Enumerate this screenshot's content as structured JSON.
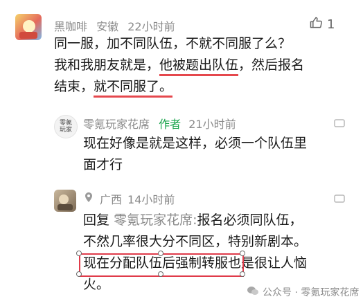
{
  "comments": [
    {
      "user": "黑咖啡",
      "location": "安徽",
      "time": "22小时前",
      "likes": "1",
      "lines": [
        "同一服，加不同队伍，不就不同服了么？",
        "我和我朋友就是，",
        "他被题出队伍",
        "，然后报名",
        "结束，",
        "就不同服了。"
      ]
    },
    {
      "user": "零氪玩家花席",
      "badge": "作者",
      "time": "21小时前",
      "avatar_text": [
        "零氪",
        "玩家"
      ],
      "lines": [
        "现在好像是就是这样，必须一个队伍里",
        "面才行"
      ]
    },
    {
      "user": "广西",
      "time": "14小时前",
      "reply_prefix": "回复",
      "reply_to": "零氪玩家花席:",
      "lines": [
        "报名必须同队伍，",
        "不然几率很大分不同区，特别新剧本。",
        "现在分配队伍后强制转服",
        "也是很让人恼",
        "火。"
      ]
    }
  ],
  "watermark": "公众号 · 零氪玩家花席",
  "icons": {
    "like": "thumbs-up-icon",
    "more": "more-icon",
    "location": "location-icon",
    "watermark": "wechat-icon"
  },
  "colors": {
    "author_badge": "#16a34a",
    "underline": "#e5484d",
    "highlight_box": "#e03b4a"
  }
}
